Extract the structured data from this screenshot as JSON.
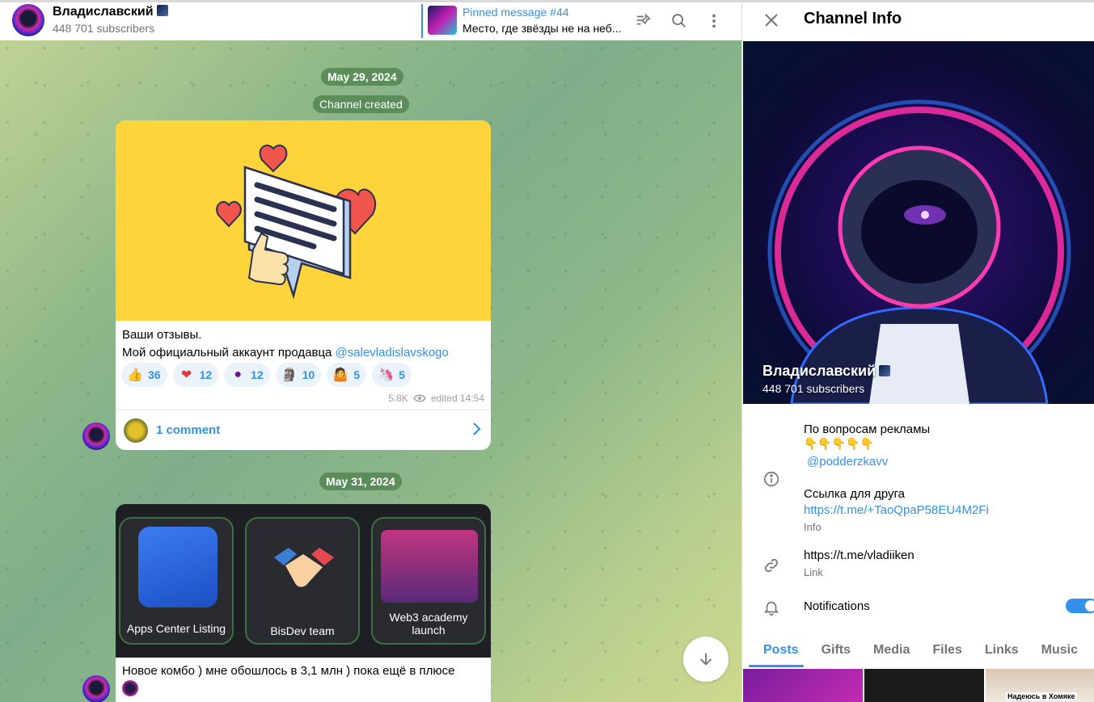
{
  "chat": {
    "header": {
      "title": "Владиславский",
      "subscribers": "448 701 subscribers",
      "pinned_title": "Pinned message #44",
      "pinned_text": "Место, где звёзды не на неб..."
    },
    "date1": "May 29, 2024",
    "system_message": "Channel created",
    "post1": {
      "line1": "Ваши отзывы.",
      "line2_prefix": "Мой официальный аккаунт продавца ",
      "mention": "@salevladislavskogo",
      "reactions": [
        {
          "emoji": "👍",
          "count": "36"
        },
        {
          "emoji": "❤",
          "count": "12"
        },
        {
          "emoji": "●",
          "count": "12"
        },
        {
          "emoji": "🗿",
          "count": "10"
        },
        {
          "emoji": "🤷",
          "count": "5"
        },
        {
          "emoji": "🦄",
          "count": "5"
        }
      ],
      "views": "5.8K",
      "edited": "edited 14:54",
      "comments": "1 comment"
    },
    "date2": "May 31, 2024",
    "post2": {
      "tiles": [
        "Apps Center Listing",
        "BisDev team",
        "Web3 academy\nlaunch"
      ],
      "text": "Новое комбо ) мне обошлось в 3,1 млн ) пока ещё в плюсе"
    }
  },
  "info": {
    "title": "Channel Info",
    "cover_name": "Владиславский",
    "cover_sub": "448 701 subscribers",
    "about_line1": "По вопросам рекламы",
    "about_line2": "👇👇👇👇👇",
    "about_mention": "@podderzkavv",
    "friend_label": "Ссылка для друга",
    "friend_link": "https://t.me/+TaoQpaP58EU4M2Fi",
    "friend_caption": "Info",
    "link_value": "https://t.me/vladiiken",
    "link_caption": "Link",
    "notifications": "Notifications",
    "notifications_on": true,
    "tabs": [
      "Posts",
      "Gifts",
      "Media",
      "Files",
      "Links",
      "Music"
    ],
    "media_caption": "Надеюсь в Хомяке"
  },
  "colors": {
    "accent": "#3390ec",
    "post_image_bg": "#ffd43b"
  }
}
